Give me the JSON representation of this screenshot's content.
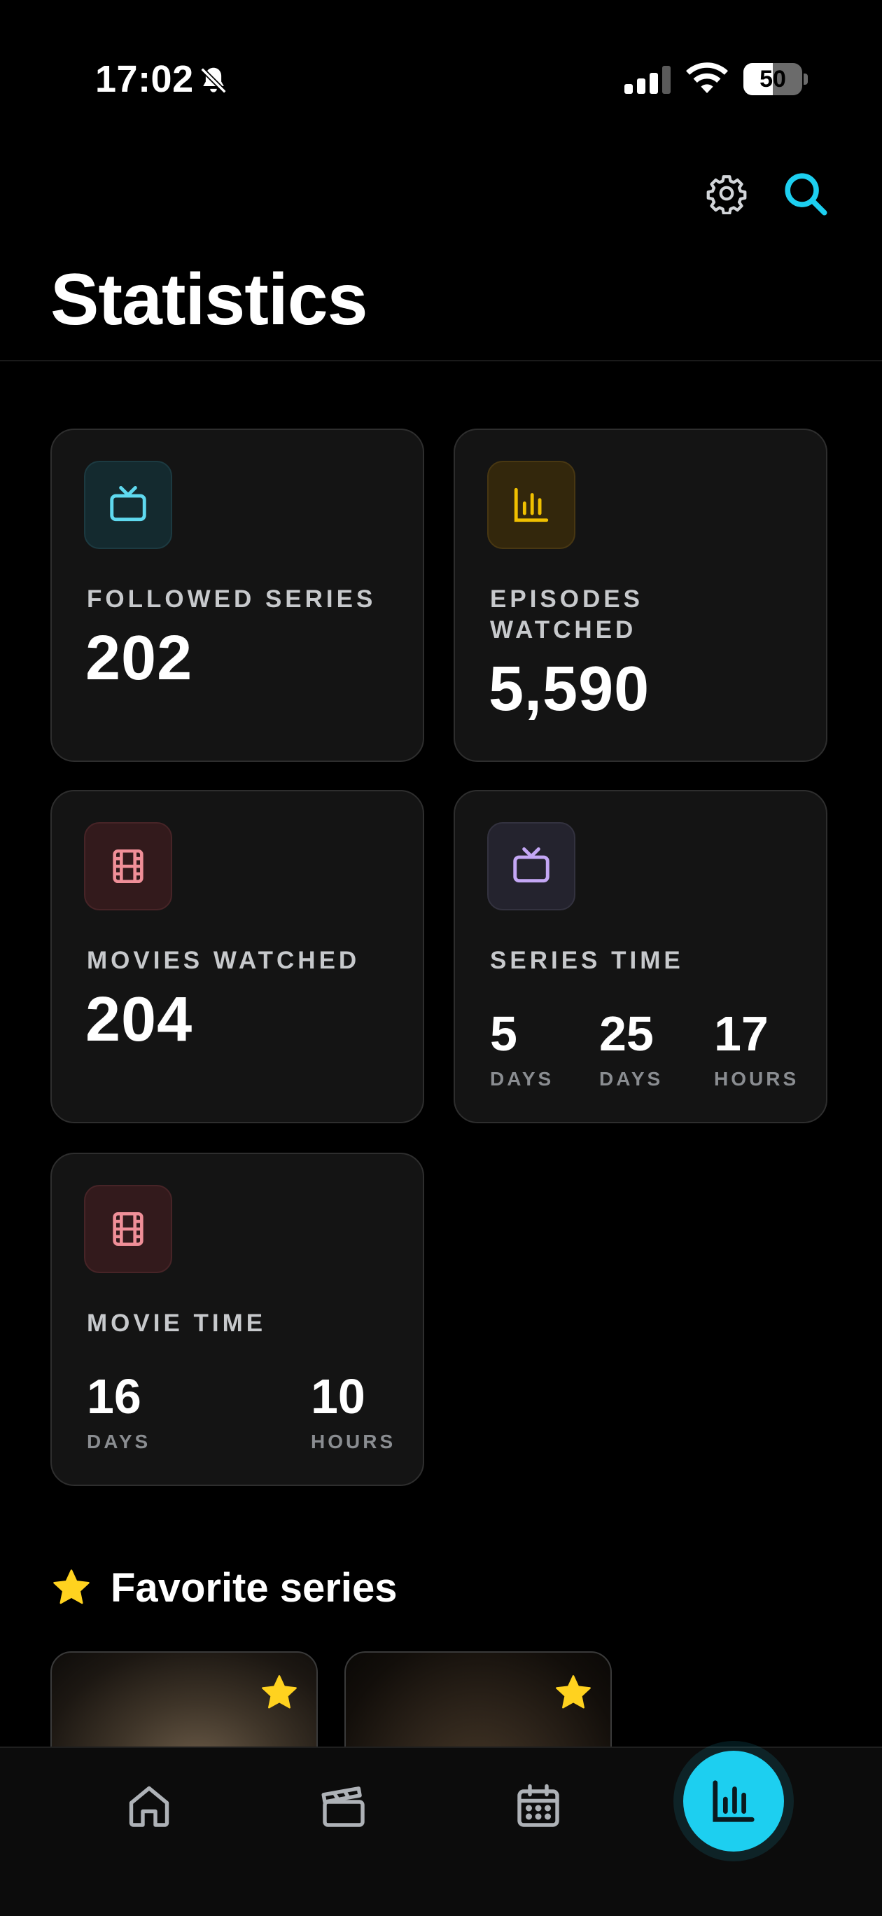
{
  "status_bar": {
    "time": "17:02",
    "battery_level": "50",
    "battery_fraction": 0.5
  },
  "header": {
    "title": "Statistics",
    "icons": [
      "gear-icon",
      "search-icon"
    ]
  },
  "colors": {
    "accent": "#1dcff0",
    "card_bg": "#141414",
    "card_border": "#2e2e2e",
    "tv_cyan": "#5fd9ef",
    "chart_yellow": "#f0c000",
    "film_pink": "#f08f98",
    "tv_purple": "#c4a7f5",
    "star_yellow": "#ffd21f"
  },
  "stats": {
    "followed_series": {
      "label": "FOLLOWED SERIES",
      "value": "202",
      "icon": "tv-icon"
    },
    "episodes_watched": {
      "label_line1": "EPISODES",
      "label_line2": "WATCHED",
      "value": "5,590",
      "icon": "bar-chart-icon"
    },
    "movies_watched": {
      "label": "MOVIES WATCHED",
      "value": "204",
      "icon": "film-icon"
    },
    "series_time": {
      "label": "SERIES TIME",
      "icon": "tv-icon",
      "parts": [
        {
          "value": "5",
          "unit": "DAYS"
        },
        {
          "value": "25",
          "unit": "DAYS"
        },
        {
          "value": "17",
          "unit": "HOURS"
        }
      ]
    },
    "movie_time": {
      "label": "MOVIE TIME",
      "icon": "film-icon",
      "parts": [
        {
          "value": "16",
          "unit": "DAYS"
        },
        {
          "value": "10",
          "unit": "HOURS"
        }
      ]
    }
  },
  "favorites": {
    "title": "Favorite series",
    "items": [
      {
        "icon": "star-icon"
      },
      {
        "icon": "star-icon"
      }
    ]
  },
  "bottom_nav": {
    "items": [
      "home-icon",
      "clapperboard-icon",
      "calendar-icon",
      "bar-chart-icon"
    ],
    "active": "bar-chart-icon"
  }
}
